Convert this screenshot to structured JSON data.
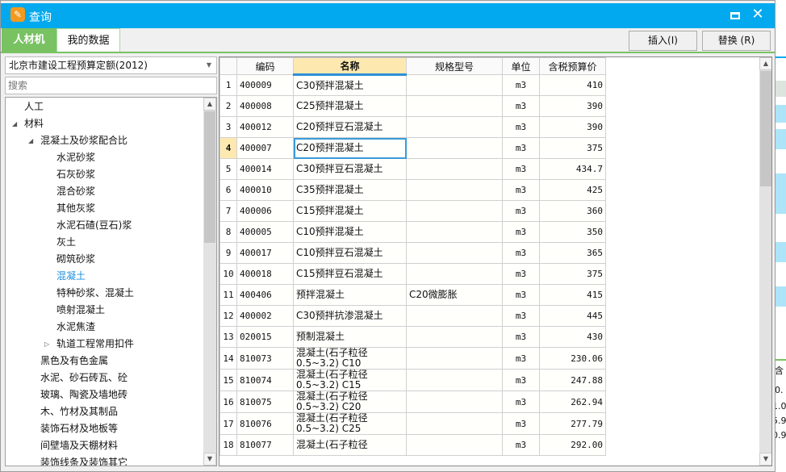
{
  "window": {
    "title": "查询",
    "icon": "app-logo-icon"
  },
  "tabs": [
    {
      "label": "人材机",
      "active": true
    },
    {
      "label": "我的数据",
      "active": false
    }
  ],
  "buttons": {
    "insert": "插入(I)",
    "replace": "替换 (R)"
  },
  "left": {
    "quota_select": "北京市建设工程预算定额(2012)",
    "search_placeholder": "搜索",
    "tree": [
      {
        "label": "人工",
        "level": 0,
        "toggle": ""
      },
      {
        "label": "材料",
        "level": 0,
        "toggle": "expanded"
      },
      {
        "label": "混凝土及砂浆配合比",
        "level": 1,
        "toggle": "expanded"
      },
      {
        "label": "水泥砂浆",
        "level": 2,
        "toggle": ""
      },
      {
        "label": "石灰砂浆",
        "level": 2,
        "toggle": ""
      },
      {
        "label": "混合砂浆",
        "level": 2,
        "toggle": ""
      },
      {
        "label": "其他灰浆",
        "level": 2,
        "toggle": ""
      },
      {
        "label": "水泥石碴(豆石)浆",
        "level": 2,
        "toggle": ""
      },
      {
        "label": "灰土",
        "level": 2,
        "toggle": ""
      },
      {
        "label": "砌筑砂浆",
        "level": 2,
        "toggle": ""
      },
      {
        "label": "混凝土",
        "level": 2,
        "toggle": "",
        "selected": true
      },
      {
        "label": "特种砂浆、混凝土",
        "level": 2,
        "toggle": ""
      },
      {
        "label": "喷射混凝土",
        "level": 2,
        "toggle": ""
      },
      {
        "label": "水泥焦渣",
        "level": 2,
        "toggle": ""
      },
      {
        "label": "轨道工程常用扣件",
        "level": 2,
        "toggle": "collapsed"
      },
      {
        "label": "黑色及有色金属",
        "level": 1,
        "toggle": ""
      },
      {
        "label": "水泥、砂石砖瓦、砼",
        "level": 1,
        "toggle": ""
      },
      {
        "label": "玻璃、陶瓷及墙地砖",
        "level": 1,
        "toggle": ""
      },
      {
        "label": "木、竹材及其制品",
        "level": 1,
        "toggle": ""
      },
      {
        "label": "装饰石材及地板等",
        "level": 1,
        "toggle": ""
      },
      {
        "label": "间壁墙及天棚材料",
        "level": 1,
        "toggle": ""
      },
      {
        "label": "装饰线条及装饰其它",
        "level": 1,
        "toggle": ""
      }
    ]
  },
  "grid": {
    "columns": [
      "",
      "编码",
      "名称",
      "规格型号",
      "单位",
      "含税预算价"
    ],
    "current_row": 4,
    "rows": [
      {
        "n": "1",
        "code": "400009",
        "name": "C30预拌混凝土",
        "spec": "",
        "unit": "m3",
        "price": "410"
      },
      {
        "n": "2",
        "code": "400008",
        "name": "C25预拌混凝土",
        "spec": "",
        "unit": "m3",
        "price": "390"
      },
      {
        "n": "3",
        "code": "400012",
        "name": "C20预拌豆石混凝土",
        "spec": "",
        "unit": "m3",
        "price": "390"
      },
      {
        "n": "4",
        "code": "400007",
        "name": "C20预拌混凝土",
        "spec": "",
        "unit": "m3",
        "price": "375"
      },
      {
        "n": "5",
        "code": "400014",
        "name": "C30预拌豆石混凝土",
        "spec": "",
        "unit": "m3",
        "price": "434.7"
      },
      {
        "n": "6",
        "code": "400010",
        "name": "C35预拌混凝土",
        "spec": "",
        "unit": "m3",
        "price": "425"
      },
      {
        "n": "7",
        "code": "400006",
        "name": "C15预拌混凝土",
        "spec": "",
        "unit": "m3",
        "price": "360"
      },
      {
        "n": "8",
        "code": "400005",
        "name": "C10预拌混凝土",
        "spec": "",
        "unit": "m3",
        "price": "350"
      },
      {
        "n": "9",
        "code": "400017",
        "name": "C10预拌豆石混凝土",
        "spec": "",
        "unit": "m3",
        "price": "365"
      },
      {
        "n": "10",
        "code": "400018",
        "name": "C15预拌豆石混凝土",
        "spec": "",
        "unit": "m3",
        "price": "375"
      },
      {
        "n": "11",
        "code": "400406",
        "name": "预拌混凝土",
        "spec": "C20微膨胀",
        "unit": "m3",
        "price": "415"
      },
      {
        "n": "12",
        "code": "400002",
        "name": "C30预拌抗渗混凝土",
        "spec": "",
        "unit": "m3",
        "price": "445"
      },
      {
        "n": "13",
        "code": "020015",
        "name": "预制混凝土",
        "spec": "",
        "unit": "m3",
        "price": "430"
      },
      {
        "n": "14",
        "code": "810073",
        "name": "混凝土(石子粒径 0.5~3.2) C10",
        "spec": "",
        "unit": "m3",
        "price": "230.06"
      },
      {
        "n": "15",
        "code": "810074",
        "name": "混凝土(石子粒径 0.5~3.2) C15",
        "spec": "",
        "unit": "m3",
        "price": "247.88"
      },
      {
        "n": "16",
        "code": "810075",
        "name": "混凝土(石子粒径 0.5~3.2) C20",
        "spec": "",
        "unit": "m3",
        "price": "262.94"
      },
      {
        "n": "17",
        "code": "810076",
        "name": "混凝土(石子粒径 0.5~3.2) C25",
        "spec": "",
        "unit": "m3",
        "price": "277.79"
      },
      {
        "n": "18",
        "code": "810077",
        "name": "混凝土(石子粒径",
        "spec": "",
        "unit": "m3",
        "price": "292.00"
      }
    ]
  },
  "background_fragments": [
    "含",
    "0.",
    "1.0",
    "5.9",
    "0.9"
  ]
}
